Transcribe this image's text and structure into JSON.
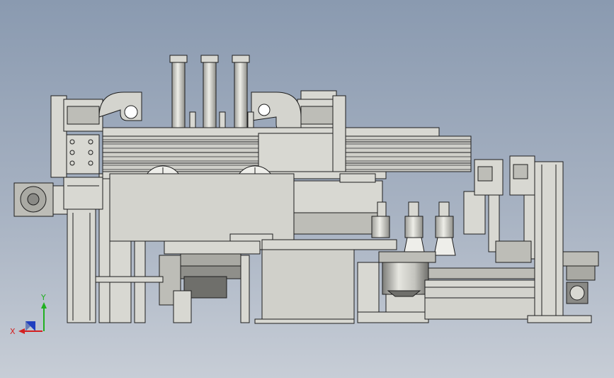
{
  "viewport": {
    "background_top": "#8a9ab0",
    "background_bottom": "#c7cdd6"
  },
  "model": {
    "body_color": "#d8d8d2",
    "shadow_color": "#9a9a94",
    "edge_color": "#1e1e1e",
    "motor_color": "#8a8a86"
  },
  "triad": {
    "x_label": "X",
    "y_label": "Y",
    "x_color": "#d42020",
    "y_color": "#20b020",
    "z_color": "#2040c0"
  }
}
